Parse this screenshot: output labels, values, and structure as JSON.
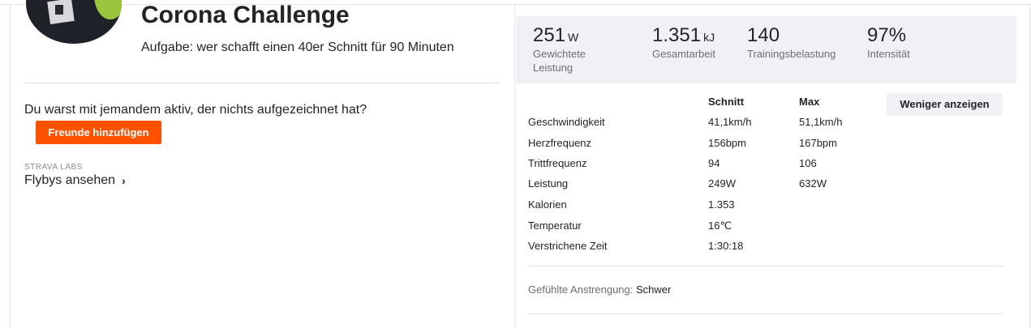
{
  "activity": {
    "title": "Corona Challenge",
    "description": "Aufgabe: wer schafft einen 40er Schnitt für 90 Minuten"
  },
  "social": {
    "question": "Du warst mit jemandem aktiv, der nichts aufgezeichnet hat?",
    "add_friends_label": "Freunde hinzufügen",
    "labs_label": "STRAVA LABS",
    "flybys_label": "Flybys ansehen"
  },
  "summary": [
    {
      "value": "251",
      "unit": "W",
      "label": "Gewichtete Leistung"
    },
    {
      "value": "1.351",
      "unit": "kJ",
      "label": "Gesamtarbeit"
    },
    {
      "value": "140",
      "unit": "",
      "label": "Trainingsbelastung"
    },
    {
      "value": "97%",
      "unit": "",
      "label": "Intensität"
    }
  ],
  "details": {
    "col_avg": "Schnitt",
    "col_max": "Max",
    "less_button": "Weniger anzeigen",
    "rows": [
      {
        "label": "Geschwindigkeit",
        "avg": "41,1km/h",
        "max": "51,1km/h"
      },
      {
        "label": "Herzfrequenz",
        "avg": "156bpm",
        "max": "167bpm"
      },
      {
        "label": "Trittfrequenz",
        "avg": "94",
        "max": "106"
      },
      {
        "label": "Leistung",
        "avg": "249W",
        "max": "632W"
      },
      {
        "label": "Kalorien",
        "avg": "1.353",
        "max": ""
      },
      {
        "label": "Temperatur",
        "avg": "16℃",
        "max": ""
      },
      {
        "label": "Verstrichene Zeit",
        "avg": "1:30:18",
        "max": ""
      }
    ]
  },
  "effort": {
    "label": "Gefühlte Anstrengung:",
    "value": "Schwer"
  },
  "colors": {
    "accent": "#fc5200",
    "stats_bg": "#f0f0f5"
  }
}
